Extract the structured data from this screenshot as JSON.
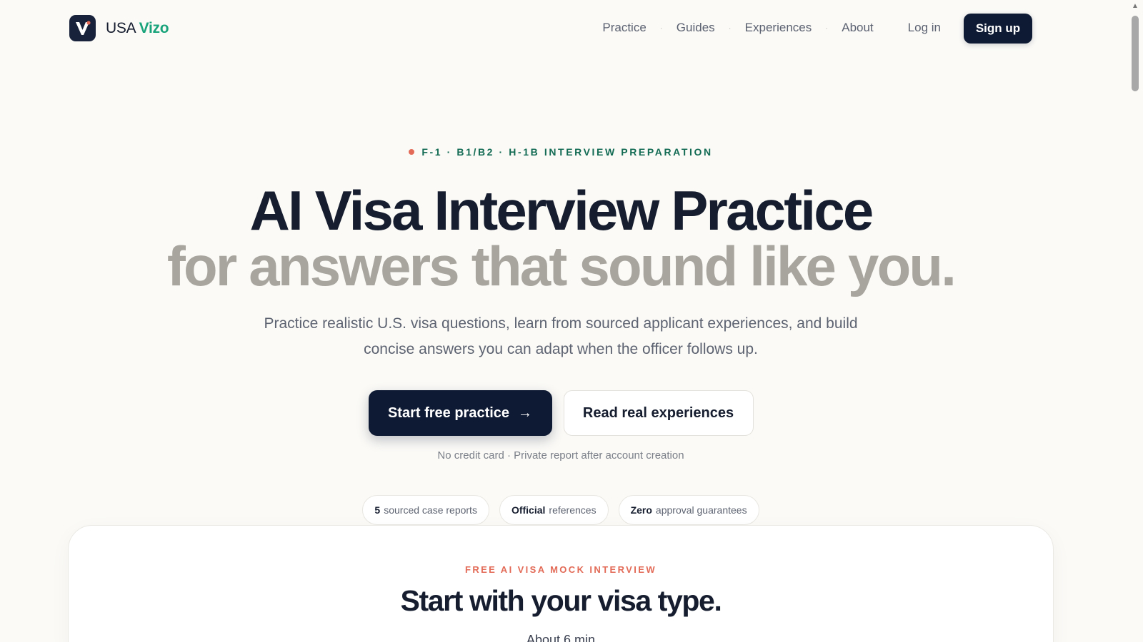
{
  "brand": {
    "name_prefix": "USA",
    "name_accent": "Vizo"
  },
  "nav": {
    "items": [
      "Practice",
      "Guides",
      "Experiences",
      "About"
    ],
    "separator": "·",
    "login": "Log in",
    "signup": "Sign up"
  },
  "hero": {
    "eyebrow": "F-1 · B1/B2 · H-1B INTERVIEW PREPARATION",
    "title_line1": "AI Visa Interview Practice",
    "title_line2": "for answers that sound like you.",
    "subtitle": "Practice realistic U.S. visa questions, learn from sourced applicant experiences, and build concise answers you can adapt when the officer follows up.",
    "cta_primary": "Start free practice",
    "cta_primary_arrow": "→",
    "cta_secondary": "Read real experiences",
    "fineprint": "No credit card · Private report after account creation"
  },
  "badges": [
    {
      "strong": "5",
      "rest": "sourced case reports"
    },
    {
      "strong": "Official",
      "rest": "references"
    },
    {
      "strong": "Zero",
      "rest": "approval guarantees"
    }
  ],
  "card": {
    "eyebrow": "FREE AI VISA MOCK INTERVIEW",
    "title": "Start with your visa type.",
    "meta": "About 6 min"
  },
  "colors": {
    "navy": "#0e1a33",
    "accent_green": "#18a37a",
    "eyebrow_green": "#136b54",
    "coral": "#e26a56",
    "muted_title": "#a8a59e"
  },
  "icons": {
    "scroll_up": "▲"
  }
}
